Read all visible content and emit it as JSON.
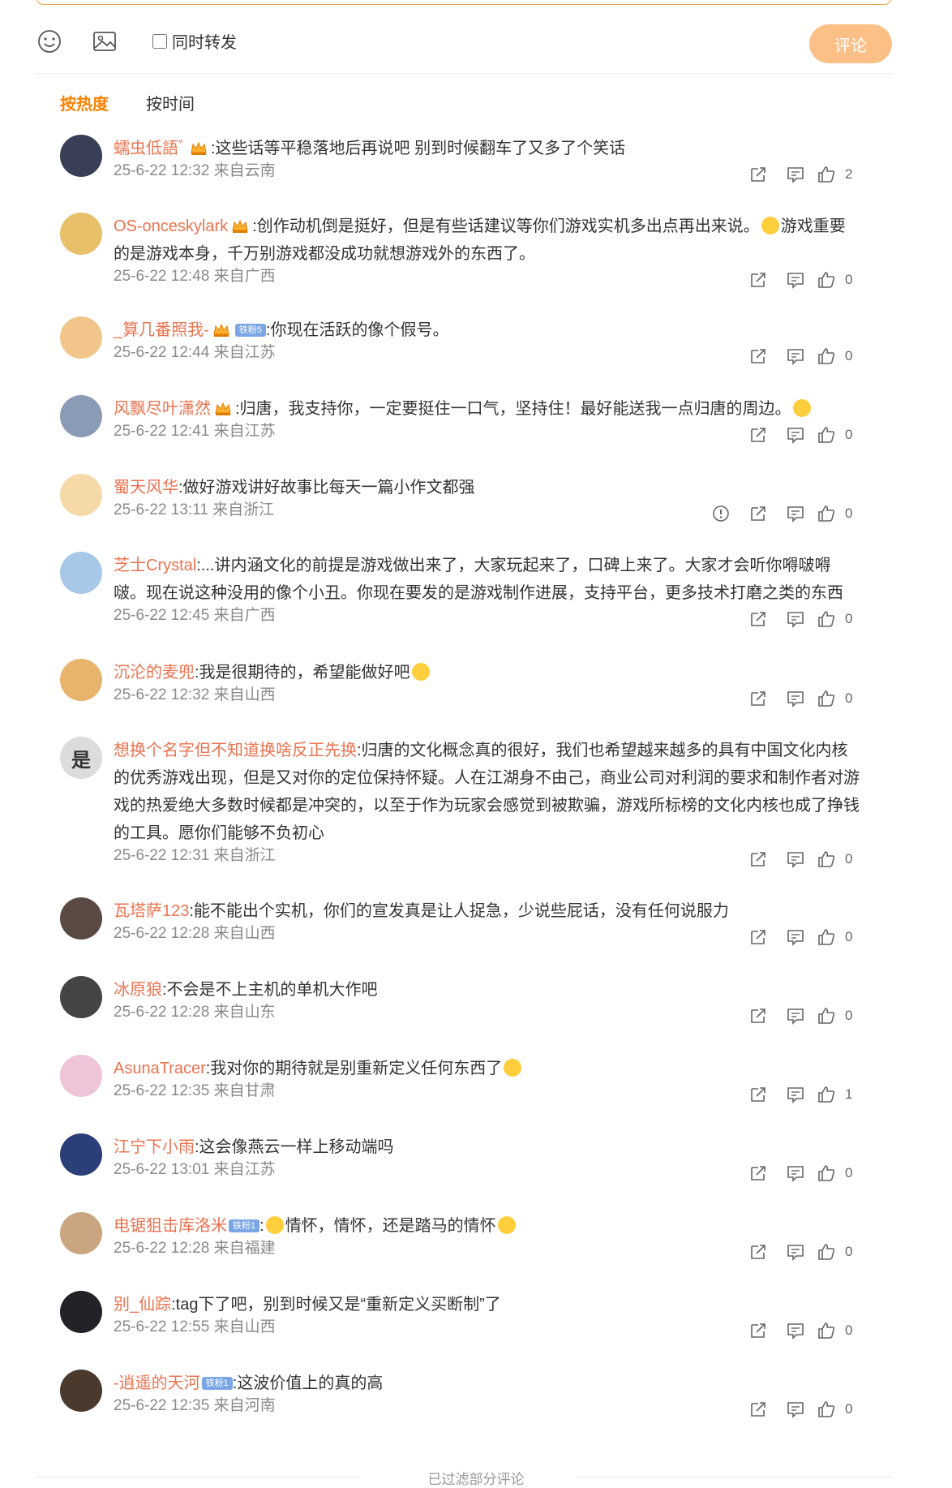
{
  "composer": {
    "repost_label": "同时转发",
    "submit_label": "评论"
  },
  "sort": {
    "hot": "按热度",
    "time": "按时间"
  },
  "comments": [
    {
      "user": "蠕虫低語ﾞ",
      "badge": "crown",
      "fan": "",
      "text": ":这些话等平稳落地后再说吧 别到时候翻车了又多了个笑话",
      "time": "25-6-22 12:32 来自云南",
      "likes": "2",
      "lines": 1,
      "avatar_color": "#3a3f58",
      "report": false
    },
    {
      "user": "OS-onceskylark",
      "badge": "crown",
      "fan": "",
      "text": ":创作动机倒是挺好，但是有些话建议等你们游戏实机多出点再出来说。",
      "text2": "游戏重要的是游戏本身，千万别游戏都没成功就想游戏外的东西了。",
      "time": "25-6-22 12:48 来自广西",
      "likes": "0",
      "lines": 2,
      "avatar_color": "#e8c06a",
      "report": false,
      "emoji_mid": true
    },
    {
      "user": "_算几番照我-",
      "badge": "crown",
      "fan": "铁粉5",
      "text": ":你现在活跃的像个假号。",
      "time": "25-6-22 12:44 来自江苏",
      "likes": "0",
      "lines": 1,
      "avatar_color": "#f2c68a",
      "report": false
    },
    {
      "user": "风飘尽叶潇然",
      "badge": "crown",
      "fan": "",
      "text": ":归唐，我支持你，一定要挺住一口气，坚持住！最好能送我一点归唐的周边。",
      "time": "25-6-22 12:41 来自江苏",
      "likes": "0",
      "lines": 1,
      "avatar_color": "#8c9bb5",
      "report": false,
      "emoji_end": true
    },
    {
      "user": "蜀天风华",
      "badge": "",
      "fan": "",
      "text": ":做好游戏讲好故事比每天一篇小作文都强",
      "time": "25-6-22 13:11 来自浙江",
      "likes": "0",
      "lines": 1,
      "avatar_color": "#f5d9a8",
      "report": true
    },
    {
      "user": "芝士Crystal",
      "badge": "",
      "fan": "",
      "text": ":...讲内涵文化的前提是游戏做出来了，大家玩起来了，口碑上来了。大家才会听你嘚啵嘚啵。现在说这种没用的像个小丑。你现在要发的是游戏制作进展，支持平台，更多技术打磨之类的东西",
      "time": "25-6-22 12:45 来自广西",
      "likes": "0",
      "lines": 2,
      "avatar_color": "#a8c8e8",
      "report": false
    },
    {
      "user": "沉沦的麦兜",
      "badge": "",
      "fan": "",
      "text": ":我是很期待的，希望能做好吧",
      "time": "25-6-22 12:32 来自山西",
      "likes": "0",
      "lines": 1,
      "avatar_color": "#e7b36d",
      "report": false,
      "emoji_end": true
    },
    {
      "user": "想换个名字但不知道换啥反正先换",
      "badge": "",
      "fan": "",
      "text": ":归唐的文化概念真的很好，我们也希望越来越多的具有中国文化内核的优秀游戏出现，但是又对你的定位保持怀疑。人在江湖身不由己，商业公司对利润的要求和制作者对游戏的热爱绝大多数时候都是冲突的，以至于作为玩家会感觉到被欺骗，游戏所标榜的文化内核也成了挣钱的工具。愿你们能够不负初心",
      "time": "25-6-22 12:31 来自浙江",
      "likes": "0",
      "lines": 4,
      "avatar_color": "#dcdcdc",
      "avatar_text": "是",
      "report": false
    },
    {
      "user": "瓦塔萨123",
      "badge": "",
      "fan": "",
      "text": ":能不能出个实机，你们的宣发真是让人捉急，少说些屁话，没有任何说服力",
      "time": "25-6-22 12:28 来自山西",
      "likes": "0",
      "lines": 1,
      "avatar_color": "#5a4a44",
      "report": false
    },
    {
      "user": "冰原狼",
      "badge": "",
      "fan": "",
      "text": ":不会是不上主机的单机大作吧",
      "time": "25-6-22 12:28 来自山东",
      "likes": "0",
      "lines": 1,
      "avatar_color": "#444444",
      "report": false
    },
    {
      "user": "AsunaTracer",
      "badge": "",
      "fan": "",
      "text": ":我对你的期待就是别重新定义任何东西了",
      "time": "25-6-22 12:35 来自甘肃",
      "likes": "1",
      "lines": 1,
      "avatar_color": "#f0c4d8",
      "report": false,
      "emoji_end": true
    },
    {
      "user": "江宁下小雨",
      "badge": "",
      "fan": "",
      "text": ":这会像燕云一样上移动端吗",
      "time": "25-6-22 13:01 来自江苏",
      "likes": "0",
      "lines": 1,
      "avatar_color": "#2c3e78",
      "report": false
    },
    {
      "user": "电锯狙击库洛米",
      "badge": "",
      "fan": "铁粉1",
      "text": ":",
      "text_after": "情怀，情怀，还是踏马的情怀",
      "time": "25-6-22 12:28 来自福建",
      "likes": "0",
      "lines": 1,
      "avatar_color": "#c9a680",
      "report": false,
      "emoji_start": true,
      "emoji_end": true
    },
    {
      "user": "别_仙踪",
      "badge": "",
      "fan": "",
      "text": ":tag下了吧，别到时候又是“重新定义买断制”了",
      "time": "25-6-22 12:55 来自山西",
      "likes": "0",
      "lines": 1,
      "avatar_color": "#222228",
      "report": false
    },
    {
      "user": "-逍遥的天河",
      "badge": "",
      "fan": "铁粉1",
      "text": ":这波价值上的真的高",
      "time": "25-6-22 12:35 来自河南",
      "likes": "0",
      "lines": 1,
      "avatar_color": "#4a3a2e",
      "report": false
    }
  ],
  "footer": {
    "note": "已过滤部分评论"
  }
}
